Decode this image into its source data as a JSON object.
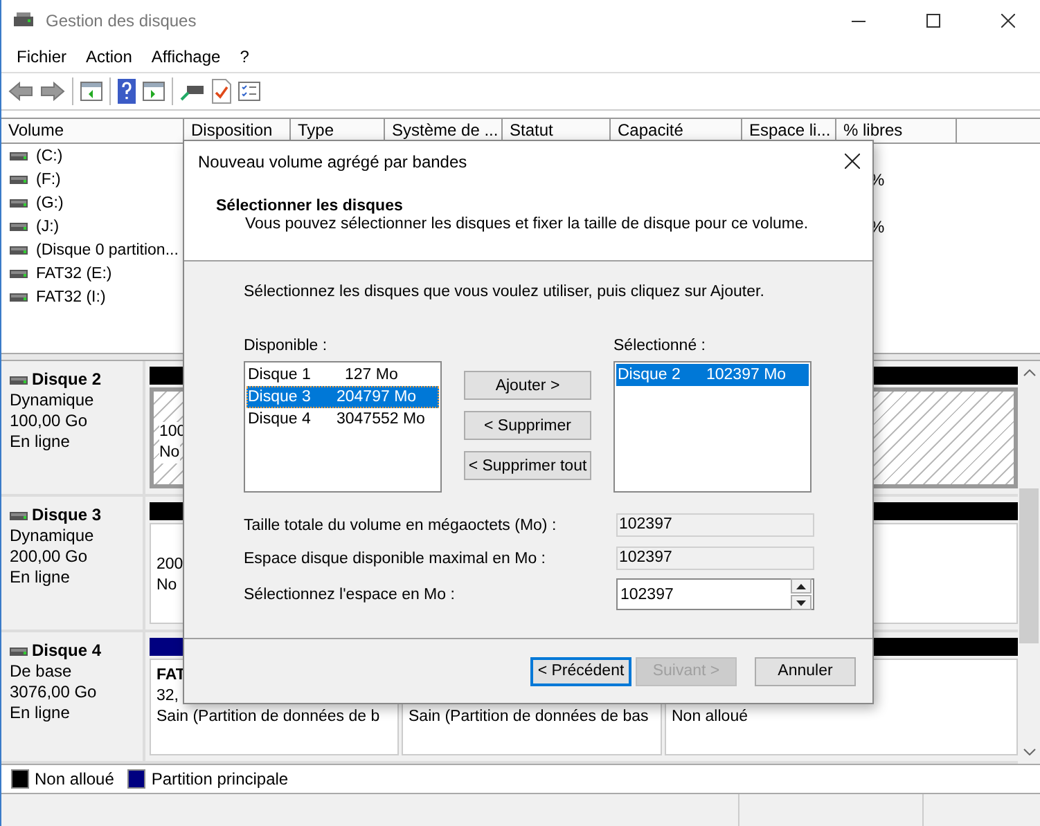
{
  "window": {
    "title": "Gestion des disques"
  },
  "menu": [
    "Fichier",
    "Action",
    "Affichage",
    "?"
  ],
  "volume_table": {
    "columns": [
      "Volume",
      "Disposition",
      "Type",
      "Système de ...",
      "Statut",
      "Capacité",
      "Espace li...",
      "% libres"
    ],
    "rows": [
      {
        "volume": "(C:)"
      },
      {
        "volume": "(F:)",
        "pct_free": "%"
      },
      {
        "volume": "(G:)"
      },
      {
        "volume": "(J:)",
        "pct_free": "%"
      },
      {
        "volume": "(Disque 0 partition..."
      },
      {
        "volume": "FAT32 (E:)"
      },
      {
        "volume": "FAT32 (I:)"
      }
    ]
  },
  "disks": [
    {
      "name": "Disque 2",
      "type": "Dynamique",
      "size": "100,00 Go",
      "status": "En ligne",
      "partitions": [
        {
          "kind": "unallocated",
          "selected": true,
          "lines": [
            "100",
            "No"
          ]
        }
      ]
    },
    {
      "name": "Disque 3",
      "type": "Dynamique",
      "size": "200,00 Go",
      "status": "En ligne",
      "partitions": [
        {
          "kind": "unallocated",
          "selected": false,
          "lines": [
            "200",
            "No"
          ]
        }
      ]
    },
    {
      "name": "Disque 4",
      "type": "De base",
      "size": "3076,00 Go",
      "status": "En ligne",
      "partitions": [
        {
          "kind": "primary",
          "selected": false,
          "label": "FAT",
          "lines": [
            "32,",
            "Sain (Partition de données de b"
          ]
        },
        {
          "selected": false,
          "lines": [
            "Sain (Partition de données de bas"
          ]
        },
        {
          "kind": "unallocated",
          "selected": false,
          "lines": [
            "Non alloué"
          ]
        }
      ]
    }
  ],
  "legend": [
    {
      "label": "Non alloué",
      "color": "#000000"
    },
    {
      "label": "Partition principale",
      "color": "#000080"
    }
  ],
  "dialog": {
    "title": "Nouveau volume agrégé par bandes",
    "heading": "Sélectionner les disques",
    "subtitle": "Vous pouvez sélectionner les disques et fixer la taille de disque pour ce volume.",
    "instruction": "Sélectionnez les disques que vous voulez utiliser, puis cliquez sur Ajouter.",
    "available": {
      "label": "Disponible :",
      "items": [
        {
          "name": "Disque 1",
          "size": "127 Mo",
          "selected": false
        },
        {
          "name": "Disque 3",
          "size": "204797 Mo",
          "selected": true
        },
        {
          "name": "Disque 4",
          "size": "3047552 Mo",
          "selected": false
        }
      ]
    },
    "actions": [
      "Ajouter >",
      "< Supprimer",
      "< Supprimer tout"
    ],
    "chosen": {
      "label": "Sélectionné :",
      "items": [
        {
          "name": "Disque 2",
          "size": "102397 Mo",
          "selected": true
        }
      ]
    },
    "fields": [
      {
        "kind": "readonly",
        "label": "Taille totale du volume en mégaoctets (Mo) :",
        "value": "102397"
      },
      {
        "kind": "readonly",
        "label": "Espace disque disponible maximal en Mo :",
        "value": "102397"
      },
      {
        "kind": "spin",
        "label": "Sélectionnez l'espace en Mo :",
        "value": "102397"
      }
    ],
    "buttons": [
      {
        "label": "< Précédent",
        "default": true,
        "disabled": false
      },
      {
        "label": "Suivant >",
        "default": false,
        "disabled": true
      },
      {
        "label": "Annuler",
        "default": false,
        "disabled": false
      }
    ]
  }
}
